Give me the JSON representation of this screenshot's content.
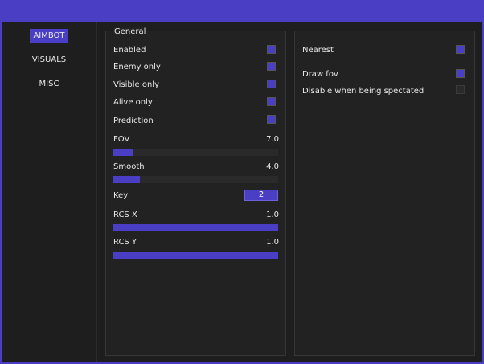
{
  "sidebar": {
    "tabs": [
      {
        "label": "AIMBOT",
        "active": true
      },
      {
        "label": "VISUALS",
        "active": false
      },
      {
        "label": "MISC",
        "active": false
      }
    ]
  },
  "general": {
    "legend": "General",
    "checkboxes": [
      {
        "label": "Enabled",
        "checked": true
      },
      {
        "label": "Enemy only",
        "checked": true
      },
      {
        "label": "Visible only",
        "checked": true
      },
      {
        "label": "Alive only",
        "checked": true
      },
      {
        "label": "Prediction",
        "checked": true
      }
    ],
    "fov": {
      "label": "FOV",
      "value": "7.0",
      "fraction": 0.12
    },
    "smooth": {
      "label": "Smooth",
      "value": "4.0",
      "fraction": 0.16
    },
    "key": {
      "label": "Key",
      "value": "2"
    },
    "rcs_x": {
      "label": "RCS X",
      "value": "1.0",
      "fraction": 1.0
    },
    "rcs_y": {
      "label": "RCS Y",
      "value": "1.0",
      "fraction": 1.0
    }
  },
  "right": {
    "checkboxes": [
      {
        "label": "Nearest",
        "checked": true
      },
      {
        "label": "Draw fov",
        "checked": true
      },
      {
        "label": "Disable when being spectated",
        "checked": false
      }
    ]
  },
  "colors": {
    "accent": "#4a3ec4",
    "background": "#1e1e1e",
    "panel": "#222222"
  }
}
